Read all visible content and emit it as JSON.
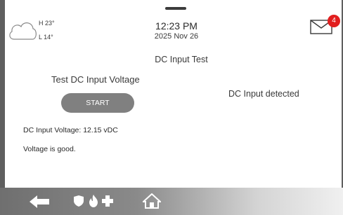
{
  "weather": {
    "high": "H 23°",
    "low": "L 14°",
    "icon": "cloud-icon"
  },
  "clock": {
    "time": "12:23 PM",
    "date": "2025 Nov 26"
  },
  "messages": {
    "icon": "envelope-icon",
    "count": "4",
    "badge_color": "#e21f1f"
  },
  "page": {
    "title": "DC Input Test"
  },
  "test": {
    "section_title": "Test DC Input Voltage",
    "start_label": "START",
    "status": "DC Input detected",
    "reading": "DC Input Voltage: 12.15 vDC",
    "result": "Voltage is good."
  },
  "bottom_nav": {
    "icons": [
      "back-arrow-icon",
      "shield-icon",
      "fire-icon",
      "medical-cross-icon",
      "home-icon"
    ]
  }
}
